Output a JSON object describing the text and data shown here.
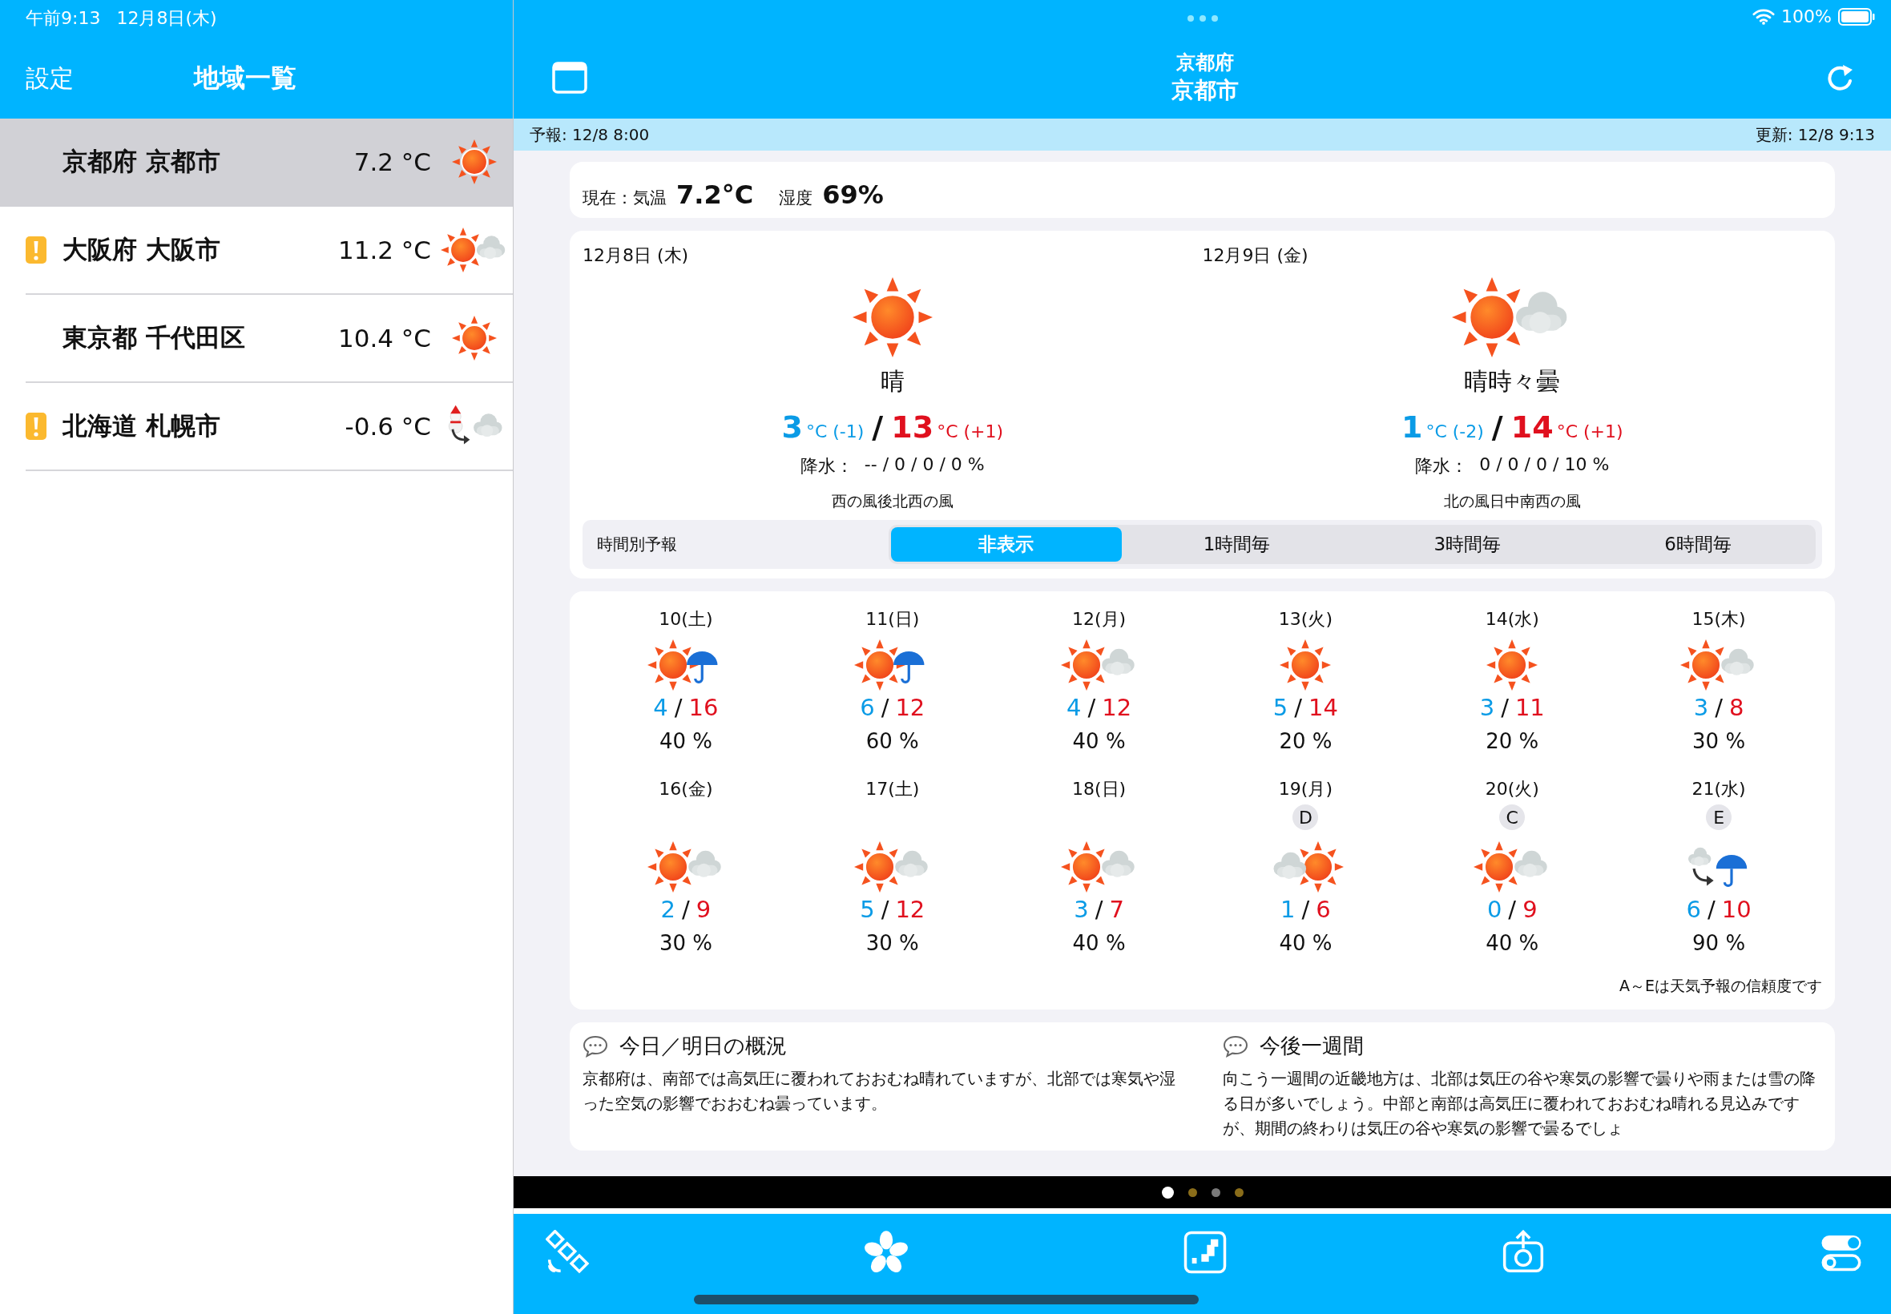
{
  "status_bar": {
    "time": "午前9:13",
    "date": "12月8日(木)",
    "battery": "100%"
  },
  "sidebar": {
    "nav": {
      "left_button": "設定",
      "title": "地域一覧"
    },
    "items": [
      {
        "name": "京都府 京都市",
        "temp": "7.2 °C",
        "warning": false,
        "selected": true,
        "kind": "sunny"
      },
      {
        "name": "大阪府 大阪市",
        "temp": "11.2 °C",
        "warning": true,
        "selected": false,
        "kind": "partly"
      },
      {
        "name": "東京都 千代田区",
        "temp": "10.4 °C",
        "warning": false,
        "selected": false,
        "kind": "sunny"
      },
      {
        "name": "北海道 札幌市",
        "temp": "-0.6 °C",
        "warning": true,
        "selected": false,
        "kind": "snowthencloud"
      }
    ]
  },
  "header": {
    "prefecture": "京都府",
    "city": "京都市"
  },
  "info_bar": {
    "forecast": "予報: 12/8 8:00",
    "updated": "更新: 12/8 9:13"
  },
  "current": {
    "temp_label": "現在：気温",
    "temp": "7.2°C",
    "humidity_label": "湿度",
    "humidity": "69%"
  },
  "days": [
    {
      "date": "12月8日 (木)",
      "kind": "sunny",
      "weather": "晴",
      "min": "3",
      "min_suffix": "°C (-1)",
      "sep": "/",
      "max": "13",
      "max_suffix": "°C (+1)",
      "precip_label": "降水：",
      "precip": "-- / 0 / 0 / 0 %",
      "wind": "西の風後北西の風"
    },
    {
      "date": "12月9日 (金)",
      "kind": "partly",
      "weather": "晴時々曇",
      "min": "1",
      "min_suffix": "°C (-2)",
      "sep": "/",
      "max": "14",
      "max_suffix": "°C (+1)",
      "precip_label": "降水：",
      "precip": "0 / 0 / 0 / 10 %",
      "wind": "北の風日中南西の風"
    }
  ],
  "hourly": {
    "label": "時間別予報",
    "options": [
      {
        "label": "非表示",
        "selected": true
      },
      {
        "label": "1時間毎",
        "selected": false
      },
      {
        "label": "3時間毎",
        "selected": false
      },
      {
        "label": "6時間毎",
        "selected": false
      }
    ]
  },
  "weekly": {
    "rows": [
      [
        {
          "date": "10(土)",
          "kind": "sunrain",
          "min": "4",
          "sep": "/",
          "max": "16",
          "pop": "40 %"
        },
        {
          "date": "11(日)",
          "kind": "sunrain",
          "min": "6",
          "sep": "/",
          "max": "12",
          "pop": "60 %"
        },
        {
          "date": "12(月)",
          "kind": "partly",
          "min": "4",
          "sep": "/",
          "max": "12",
          "pop": "40 %"
        },
        {
          "date": "13(火)",
          "kind": "sunny",
          "min": "5",
          "sep": "/",
          "max": "14",
          "pop": "20 %"
        },
        {
          "date": "14(水)",
          "kind": "sunny",
          "min": "3",
          "sep": "/",
          "max": "11",
          "pop": "20 %"
        },
        {
          "date": "15(木)",
          "kind": "partly",
          "min": "3",
          "sep": "/",
          "max": "8",
          "pop": "30 %"
        }
      ],
      [
        {
          "date": "16(金)",
          "kind": "partly",
          "min": "2",
          "sep": "/",
          "max": "9",
          "pop": "30 %"
        },
        {
          "date": "17(土)",
          "kind": "partly",
          "min": "5",
          "sep": "/",
          "max": "12",
          "pop": "30 %"
        },
        {
          "date": "18(日)",
          "kind": "partly",
          "min": "3",
          "sep": "/",
          "max": "7",
          "pop": "40 %"
        },
        {
          "date": "19(月)",
          "reliability": "D",
          "kind": "cloudsun",
          "min": "1",
          "sep": "/",
          "max": "6",
          "pop": "40 %"
        },
        {
          "date": "20(火)",
          "reliability": "C",
          "kind": "partly",
          "min": "0",
          "sep": "/",
          "max": "9",
          "pop": "40 %"
        },
        {
          "date": "21(水)",
          "reliability": "E",
          "kind": "cloudthenrain",
          "min": "6",
          "sep": "/",
          "max": "10",
          "pop": "90 %"
        }
      ]
    ],
    "note": "A～Eは天気予報の信頼度です"
  },
  "summaries": [
    {
      "title": "今日／明日の概況",
      "text": "京都府は、南部では高気圧に覆われておおむね晴れていますが、北部では寒気や湿った空気の影響でおおむね曇っています。"
    },
    {
      "title": "今後一週間",
      "text": "向こう一週間の近畿地方は、北部は気圧の谷や寒気の影響で曇りや雨または雪の降る日が多いでしょう。中部と南部は高気圧に覆われておおむね晴れる見込みですが、期間の終わりは気圧の谷や寒気の影響で曇るでしょ"
    }
  ],
  "page_dots": [
    {
      "selected": true,
      "color": "#ffffff"
    },
    {
      "selected": false,
      "color": "#8a6d1a"
    },
    {
      "selected": false,
      "color": "#7a7a7a"
    },
    {
      "selected": false,
      "color": "#8a6d1a"
    }
  ]
}
